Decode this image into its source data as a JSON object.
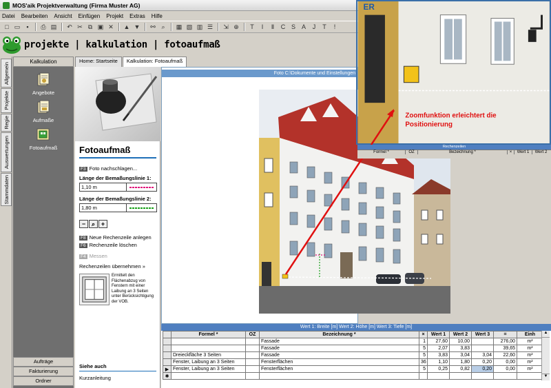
{
  "window": {
    "title": "MOS'aik Projektverwaltung (Firma Muster AG)"
  },
  "menu": [
    "Datei",
    "Bearbeiten",
    "Ansicht",
    "Einfügen",
    "Projekt",
    "Extras",
    "Hilfe"
  ],
  "brand": {
    "text": "projekte | kalkulation | fotoaufmaß"
  },
  "vertical_tabs": [
    "Allgemein",
    "Projekte",
    "Regie",
    "Auswertungen",
    "Stammdaten"
  ],
  "nav": {
    "header": "Kalkulation",
    "items": [
      {
        "label": "Angebote",
        "icon": "documents-icon"
      },
      {
        "label": "Aufmaße",
        "icon": "measure-documents-icon"
      },
      {
        "label": "Fotoaufmaß",
        "icon": "photo-measure-icon"
      }
    ],
    "footer": [
      "Aufträge",
      "Fakturierung",
      "Ordner"
    ]
  },
  "tabs": [
    {
      "label": "Home: Startseite",
      "active": false
    },
    {
      "label": "Kalkulation: Fotoaufmaß",
      "active": true
    }
  ],
  "taskpane": {
    "title": "Fotoaufmaß",
    "f3_key": "F3",
    "f3_label": "Foto nachschlagen...",
    "line1_label": "Länge der Bemaßungslinie 1:",
    "line1_value": "1,10 m",
    "line1_color": "#e0107a",
    "line2_label": "Länge der Bemaßungslinie 2:",
    "line2_value": "1,80 m",
    "line2_color": "#18a018",
    "f8_key": "F8",
    "f8_label": "Neue Rechenzeile anlegen",
    "f6_key": "F6",
    "f6_label": "Rechenzeile löschen",
    "f4_key": "F4",
    "f4_label": "Messen",
    "take_over": "Rechenzeilen übernehmen »",
    "description": "Ermittelt den Flächenabzug von Fenstern mit einer Laibung an 3 Seiten unter Berücksichtigung der VOB.",
    "see_also": "Siehe auch",
    "short_guide": "Kurzanleitung"
  },
  "viewer": {
    "caption": "Foto C:\\Dokumente und Einstellungen"
  },
  "zoom": {
    "annotation_line1": "Zoomfunktion erleichtert die",
    "annotation_line2": "Positionierung",
    "mini_grid_caption": "Rechenzeilen",
    "mini_grid_headers": [
      "Formel *",
      "OZ",
      "Bezeichnung *",
      "×",
      "Wert 1",
      "Wert 2"
    ]
  },
  "grid": {
    "caption": "Wert 1: Breite [m]  Wert 2: Höhe [m]  Wert 3: Tiefe [m]",
    "headers": [
      "Formel *",
      "OZ",
      "Bezeichnung *",
      "×",
      "Wert 1",
      "Wert 2",
      "Wert 3",
      "=",
      "Einh"
    ],
    "rows": [
      [
        "",
        "",
        "Fassade",
        "1",
        "27,60",
        "10,00",
        "",
        "276,00",
        "m²"
      ],
      [
        "",
        "",
        "Fassade",
        "5",
        "2,07",
        "3,83",
        "",
        "39,65",
        "m²"
      ],
      [
        "Dreieckfläche 3 Seiten",
        "",
        "Fassade",
        "5",
        "3,83",
        "3,04",
        "3,04",
        "22,60",
        "m²"
      ],
      [
        "Fenster, Laibung an 3 Seiten",
        "",
        "Fensterflächen",
        "36",
        "1,10",
        "1,80",
        "0,20",
        "0,00",
        "m²"
      ],
      [
        "Fenster, Laibung an 3 Seiten",
        "",
        "Fensterflächen",
        "5",
        "0,25",
        "0,82",
        "0,20",
        "0,00",
        "m²"
      ]
    ]
  }
}
